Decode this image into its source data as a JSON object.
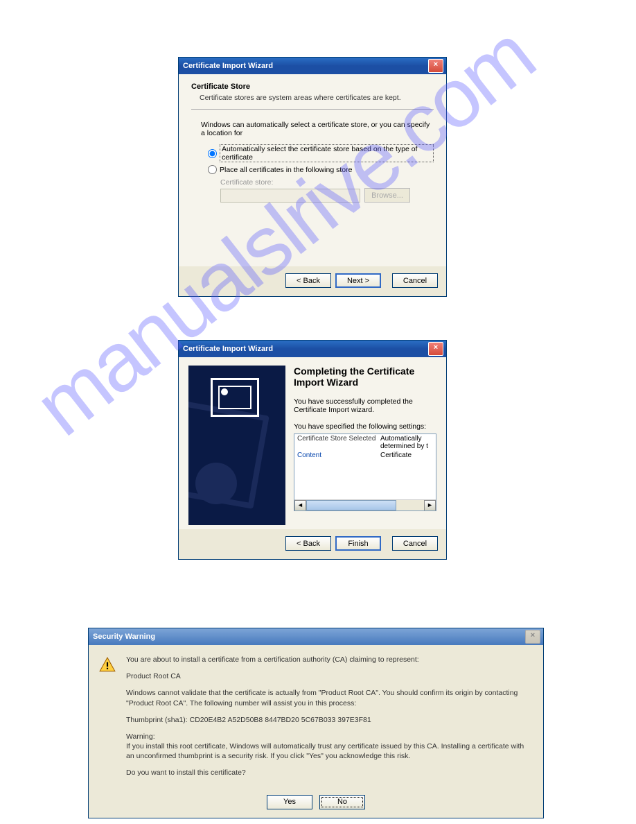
{
  "watermark": "manualslrive.com",
  "window1": {
    "title": "Certificate Import Wizard",
    "heading": "Certificate Store",
    "desc": "Certificate stores are system areas where certificates are kept.",
    "instr": "Windows can automatically select a certificate store, or you can specify a location for",
    "radio1": "Automatically select the certificate store based on the type of certificate",
    "radio2": "Place all certificates in the following store",
    "storelabel": "Certificate store:",
    "browse": "Browse...",
    "back": "< Back",
    "next": "Next >",
    "cancel": "Cancel"
  },
  "window2": {
    "title": "Certificate Import Wizard",
    "heading": "Completing the Certificate Import Wizard",
    "para1": "You have successfully completed the Certificate Import wizard.",
    "para2": "You have specified the following settings:",
    "row1c1": "Certificate Store Selected",
    "row1c2": "Automatically determined by t",
    "row2c1": "Content",
    "row2c2": "Certificate",
    "back": "< Back",
    "finish": "Finish",
    "cancel": "Cancel"
  },
  "window3": {
    "title": "Security Warning",
    "p1": "You are about to install a certificate from a certification authority (CA) claiming to represent:",
    "p2": "Product Root CA",
    "p3": "Windows cannot validate that the certificate is actually from \"Product Root CA\". You should confirm its origin by contacting \"Product Root CA\". The following number will assist you in this process:",
    "p4": "Thumbprint (sha1): CD20E4B2 A52D50B8 8447BD20 5C67B033 397E3F81",
    "p5a": "Warning:",
    "p5b": "If you install this root certificate, Windows will automatically trust any certificate issued by this CA. Installing a certificate with an unconfirmed thumbprint is a security risk. If you click \"Yes\" you acknowledge this risk.",
    "p6": "Do you want to install this certificate?",
    "yes": "Yes",
    "no": "No"
  }
}
